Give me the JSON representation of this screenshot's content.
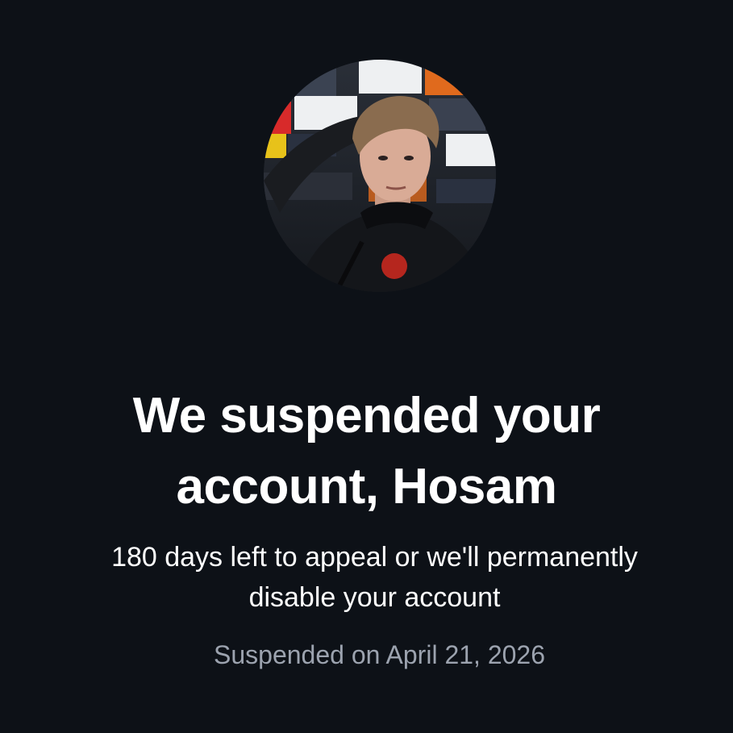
{
  "profile": {
    "avatar_icon": "profile-photo"
  },
  "notice": {
    "title_line1": "We suspended your",
    "title_line2": "account, Hosam",
    "subtitle_line1": "180 days left to appeal or we'll permanently",
    "subtitle_line2": "disable your account",
    "suspended_on": "Suspended on April 21, 2026"
  },
  "colors": {
    "background": "#0d1117",
    "title": "#ffffff",
    "muted": "#9ca3af"
  }
}
